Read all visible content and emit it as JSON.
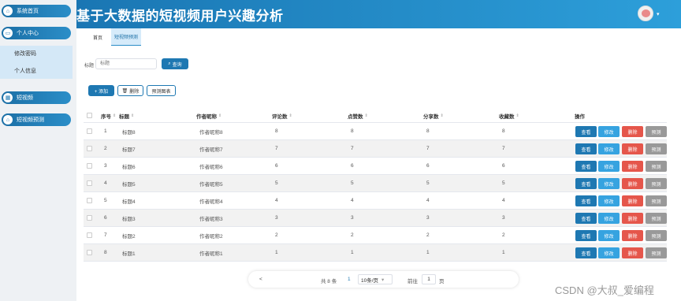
{
  "sidebar": {
    "items": [
      {
        "label": "系统首页",
        "icon": "home-icon",
        "glyph": "⌂"
      },
      {
        "label": "个人中心",
        "icon": "user-card-icon",
        "glyph": "▭"
      },
      {
        "label": "短视频",
        "icon": "grid-icon",
        "glyph": "▦"
      },
      {
        "label": "短视频预测",
        "icon": "home-icon",
        "glyph": "⌂"
      }
    ],
    "submenu": [
      "修改密码",
      "个人信息"
    ]
  },
  "header": {
    "title": "基于大数据的短视频用户兴趣分析",
    "caret": "▾"
  },
  "tabs": [
    {
      "label": "首页"
    },
    {
      "label": "短视频预测"
    }
  ],
  "search": {
    "label": "标题",
    "placeholder": "标题",
    "button": "查询",
    "icon": "search-icon"
  },
  "toolbar": {
    "add": "+ 添加",
    "delete": "删除",
    "predict_chart": "预测图表"
  },
  "table": {
    "columns": [
      "序号",
      "标题",
      "作者昵称",
      "评论数",
      "点赞数",
      "分享数",
      "收藏数",
      "操作"
    ],
    "rows": [
      [
        "1",
        "标题8",
        "作者昵称8",
        "8",
        "8",
        "8",
        "8"
      ],
      [
        "2",
        "标题7",
        "作者昵称7",
        "7",
        "7",
        "7",
        "7"
      ],
      [
        "3",
        "标题6",
        "作者昵称6",
        "6",
        "6",
        "6",
        "6"
      ],
      [
        "4",
        "标题5",
        "作者昵称5",
        "5",
        "5",
        "5",
        "5"
      ],
      [
        "5",
        "标题4",
        "作者昵称4",
        "4",
        "4",
        "4",
        "4"
      ],
      [
        "6",
        "标题3",
        "作者昵称3",
        "3",
        "3",
        "3",
        "3"
      ],
      [
        "7",
        "标题2",
        "作者昵称2",
        "2",
        "2",
        "2",
        "2"
      ],
      [
        "8",
        "标题1",
        "作者昵称1",
        "1",
        "1",
        "1",
        "1"
      ]
    ],
    "actions": [
      "查看",
      "修改",
      "删除",
      "预测"
    ]
  },
  "pagination": {
    "prev": "<",
    "total": "共 8 条",
    "current": "1",
    "page_size": "10条/页",
    "goto_label": "前往",
    "goto_value": "1",
    "page_suffix": "页"
  },
  "watermark": "CSDN @大叔_爱编程",
  "colors": {
    "primary": "#1e78b2",
    "edit": "#36a3e0",
    "delete": "#e5564b",
    "predict": "#999999"
  }
}
